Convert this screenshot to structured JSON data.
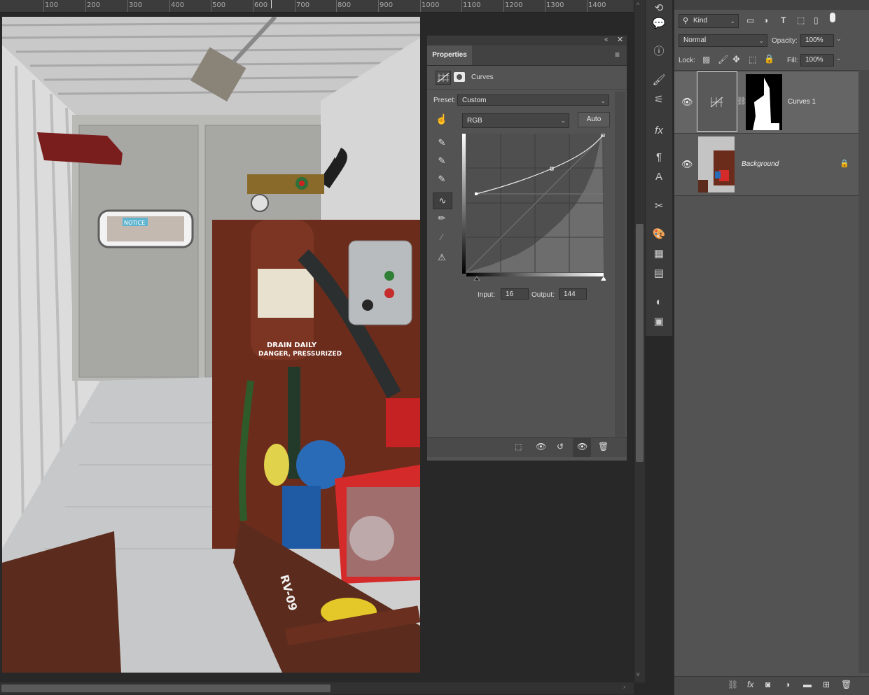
{
  "ruler": {
    "ticks": [
      "100",
      "200",
      "300",
      "400",
      "500",
      "600",
      "700",
      "800",
      "900",
      "1000",
      "1100",
      "1200",
      "1300",
      "1400"
    ]
  },
  "properties": {
    "tab_label": "Properties",
    "layer_type": "Curves",
    "preset_label": "Preset:",
    "preset_value": "Custom",
    "channel_value": "RGB",
    "auto_button": "Auto",
    "input_label": "Input:",
    "input_value": "16",
    "output_label": "Output:",
    "output_value": "144"
  },
  "layers_panel": {
    "filter_kind": "Kind",
    "blend_mode": "Normal",
    "opacity_label": "Opacity:",
    "opacity_value": "100%",
    "lock_label": "Lock:",
    "fill_label": "Fill:",
    "fill_value": "100%",
    "layers": [
      {
        "name": "Curves 1",
        "visible": true
      },
      {
        "name": "Background",
        "visible": true,
        "locked": true
      }
    ]
  },
  "photo": {
    "notice_text": "NOTICE",
    "drain_text": "DRAIN DAILY",
    "danger_text": "DANGER, PRESSURIZED",
    "unit_text": "RV-09"
  },
  "colors": {
    "panel_bg": "#535353",
    "dark_bg": "#282828",
    "accent_selection": "#656565"
  }
}
